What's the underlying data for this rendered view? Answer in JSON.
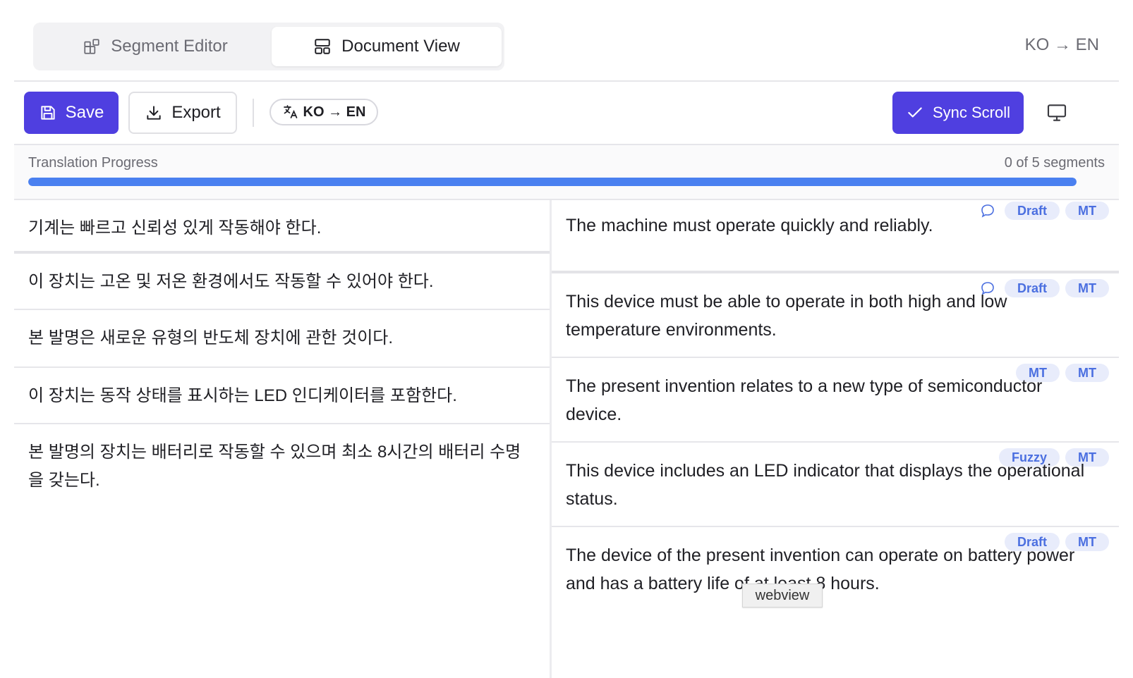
{
  "view_switch": {
    "tabs": [
      {
        "label": "Segment Editor",
        "icon": "segment-editor-icon",
        "active": false
      },
      {
        "label": "Document View",
        "icon": "document-view-icon",
        "active": true
      }
    ]
  },
  "header": {
    "language_pair": "KO → EN"
  },
  "toolbar": {
    "save_label": "Save",
    "export_label": "Export",
    "language_chip": "KO → EN",
    "sync_label": "Sync Scroll"
  },
  "progress": {
    "label": "Translation Progress",
    "count_text": "0 of 5 segments",
    "fill_fraction": 1.0,
    "fill_color": "#4a80f0"
  },
  "accent_color": "#4f3fe0",
  "source_segments": [
    "기계는 빠르고 신뢰성 있게 작동해야 한다.",
    "이 장치는 고온 및 저온 환경에서도 작동할 수 있어야 한다.",
    "본 발명은 새로운 유형의 반도체 장치에 관한 것이다.",
    "이 장치는 동작 상태를 표시하는 LED 인디케이터를 포함한다.",
    "본 발명의 장치는 배터리로 작동할 수 있으며 최소 8시간의 배터리 수명을 갖는다."
  ],
  "target_segments": [
    {
      "text": "The machine must operate quickly and reliably.",
      "badges": [
        "Draft",
        "MT"
      ],
      "comment": true
    },
    {
      "text": "This device must be able to operate in both high and low temperature environments.",
      "badges": [
        "Draft",
        "MT"
      ],
      "comment": true
    },
    {
      "text": "The present invention relates to a new type of semiconductor device.",
      "badges": [
        "MT",
        "MT"
      ],
      "comment": false
    },
    {
      "text": "This device includes an LED indicator that displays the operational status.",
      "badges": [
        "Fuzzy",
        "MT"
      ],
      "comment": false
    },
    {
      "text": "The device of the present invention can operate on battery power and has a battery life of at least 8 hours.",
      "badges": [
        "Draft",
        "MT"
      ],
      "comment": false
    }
  ],
  "tooltip": {
    "text": "webview"
  }
}
